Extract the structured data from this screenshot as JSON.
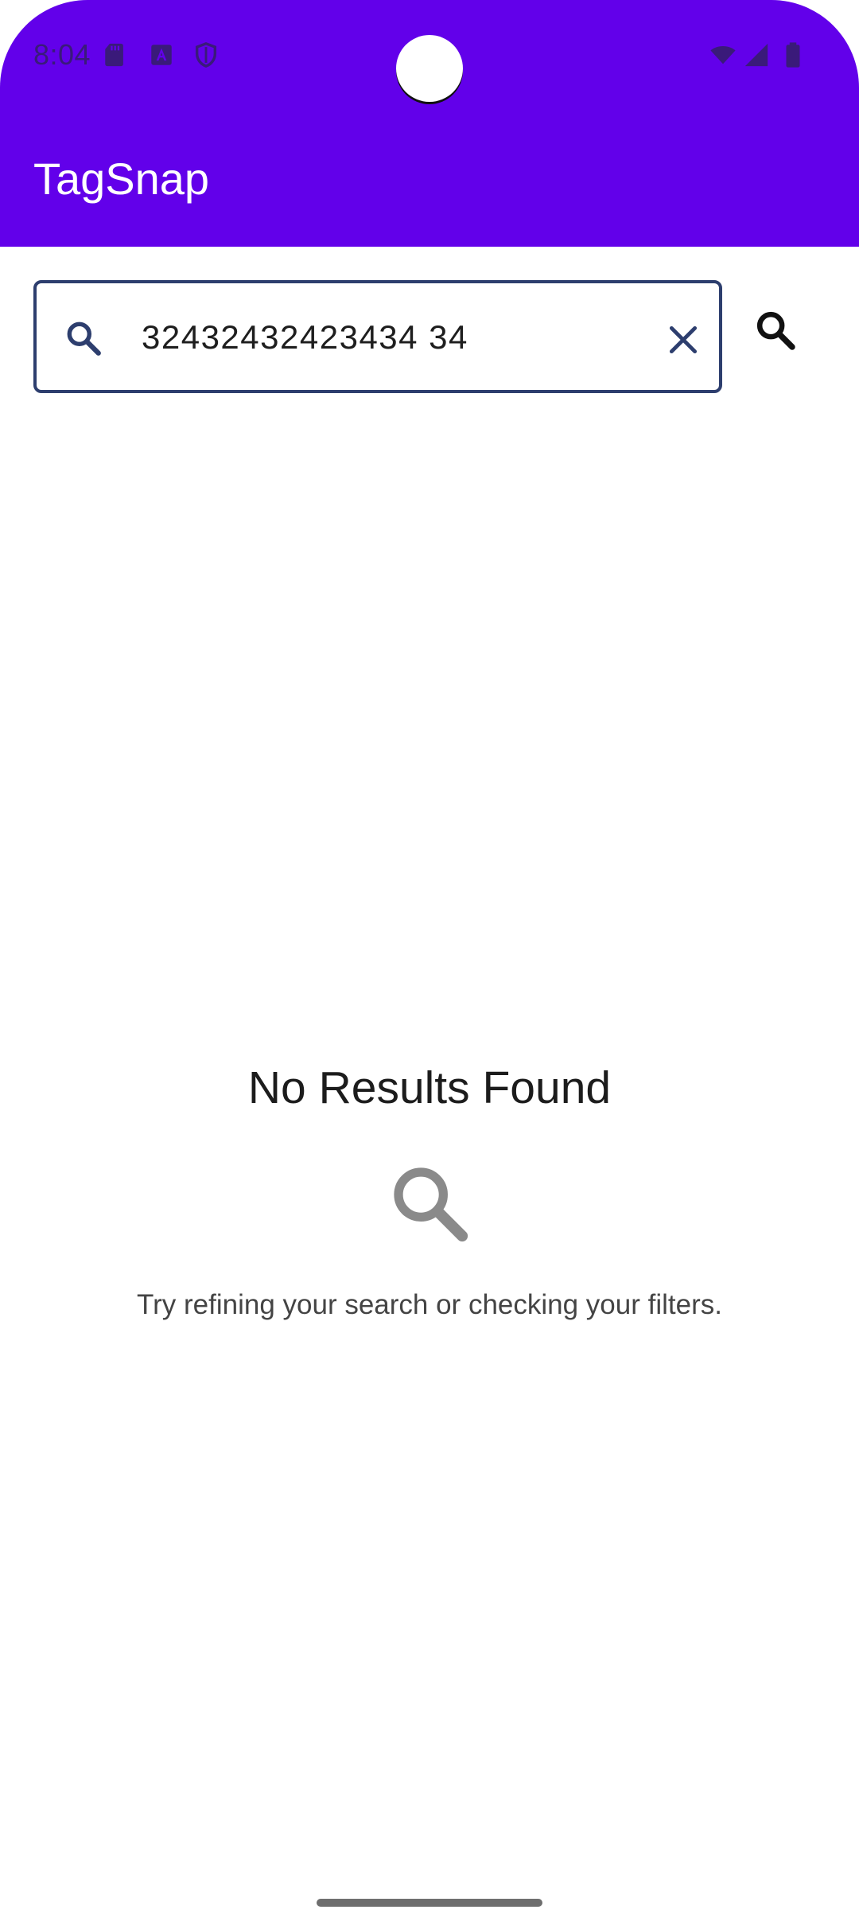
{
  "status_bar": {
    "time": "8:04",
    "left_icons": [
      "sd-card-icon",
      "keyboard-a-icon",
      "shield-icon"
    ],
    "right_icons": [
      "wifi-icon",
      "signal-icon",
      "battery-icon"
    ]
  },
  "app_bar": {
    "title": "TagSnap",
    "color": "#6200ea"
  },
  "search": {
    "value": "32432432423434 34",
    "leading_icon": "search-icon",
    "clear_icon": "close-icon",
    "action_icon": "search-icon",
    "border_color": "#2d3e6e"
  },
  "empty_state": {
    "title": "No Results Found",
    "icon": "search-icon",
    "hint": "Try refining your search or checking your filters."
  }
}
